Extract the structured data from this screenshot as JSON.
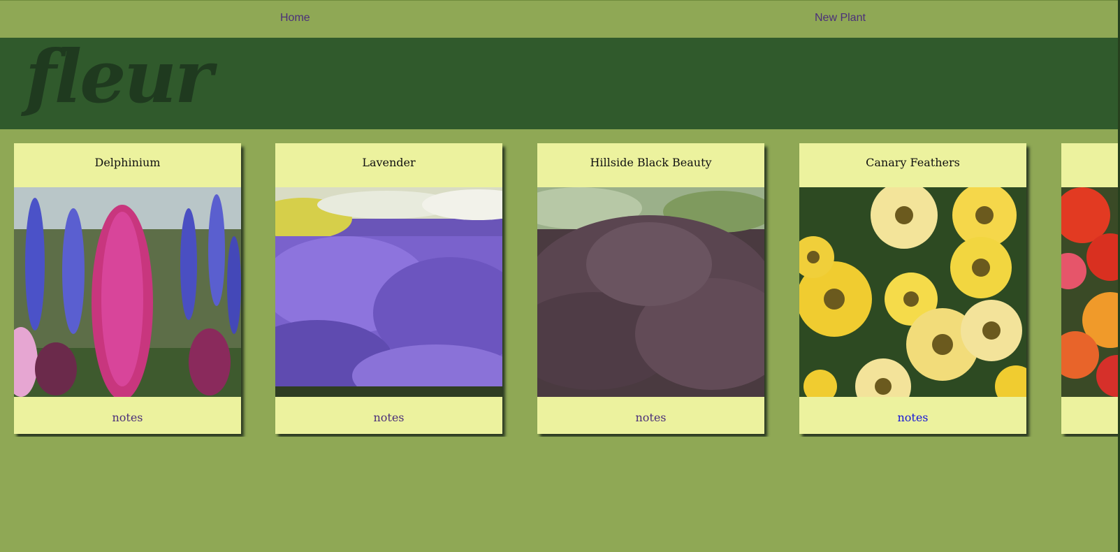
{
  "nav": {
    "home_label": "Home",
    "new_plant_label": "New Plant"
  },
  "banner": {
    "logo_text": "fleur"
  },
  "plants": [
    {
      "name": "Delphinium",
      "notes_label": "notes"
    },
    {
      "name": "Lavender",
      "notes_label": "notes"
    },
    {
      "name": "Hillside Black Beauty",
      "notes_label": "notes"
    },
    {
      "name": "Canary Feathers",
      "notes_label": "notes"
    },
    {
      "name": "",
      "notes_label": ""
    }
  ],
  "colors": {
    "page_background": "#8fa855",
    "banner_background": "#305a2c",
    "card_background": "#ecf29e",
    "link_color": "#4b2f7a",
    "active_link_color": "#1515d8"
  }
}
